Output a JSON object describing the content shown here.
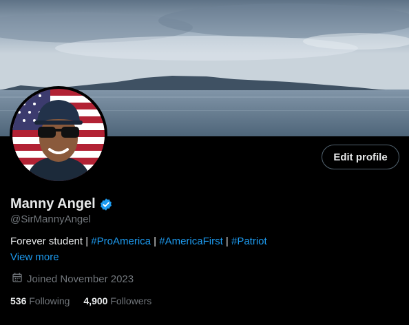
{
  "profile": {
    "name": "Manny Angel",
    "handle": "@SirMannyAngel",
    "verified_icon": "verified-badge-icon",
    "accent_color": "#1d9bf0",
    "edit_label": "Edit profile",
    "bio": {
      "prefix": "Forever student | ",
      "tag1": "#ProAmerica",
      "sep1": " | ",
      "tag2": "#AmericaFirst",
      "sep2": " | ",
      "tag3": "#Patriot"
    },
    "view_more": "View more",
    "joined": "Joined November 2023",
    "following_count": "536",
    "following_label": "Following",
    "followers_count": "4,900",
    "followers_label": "Followers"
  }
}
